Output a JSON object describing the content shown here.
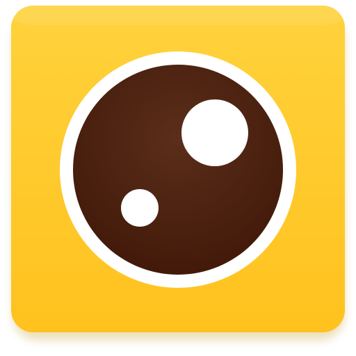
{
  "app_icon": {
    "icon_name": "camera-lens-icon",
    "colors": {
      "tile_top": "#FFD23C",
      "tile_bottom": "#FFC21E",
      "tile_shadow": "#B98700",
      "ring": "#FFFFFF",
      "lens_top": "#5A2E1A",
      "lens_bottom": "#3F1607",
      "highlight": "#FFFFFF"
    }
  }
}
